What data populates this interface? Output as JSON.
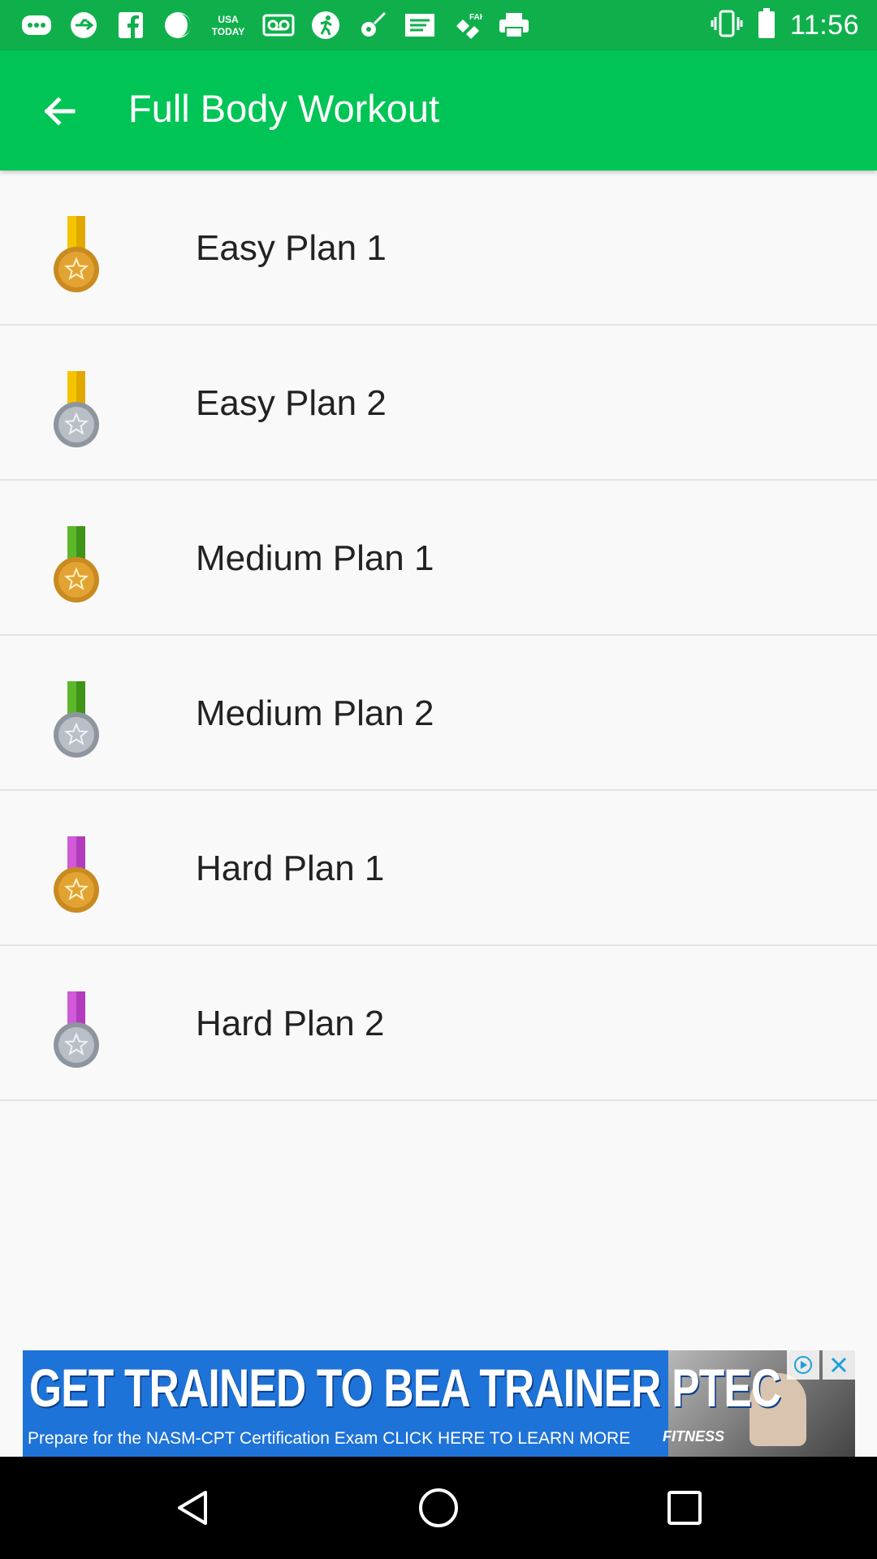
{
  "status_bar": {
    "time": "11:56",
    "left_icons": [
      "chat-icon",
      "usb-icon",
      "facebook-icon",
      "moon-icon",
      "usa-today-icon",
      "voicemail-icon",
      "run-icon",
      "guitar-icon",
      "message-icon",
      "fake-gps-icon",
      "print-icon"
    ],
    "usa_today_text": "USA TODAY",
    "fake_text": "FAKE"
  },
  "app_bar": {
    "title": "Full Body Workout",
    "color": "#00c455"
  },
  "plans": [
    {
      "label": "Easy Plan 1",
      "ribbon": "#f5c400",
      "ribbon_dark": "#e0a800",
      "medal": "gold"
    },
    {
      "label": "Easy Plan 2",
      "ribbon": "#f5c400",
      "ribbon_dark": "#e0a800",
      "medal": "silver"
    },
    {
      "label": "Medium Plan 1",
      "ribbon": "#5cb82a",
      "ribbon_dark": "#3e9318",
      "medal": "gold"
    },
    {
      "label": "Medium Plan 2",
      "ribbon": "#5cb82a",
      "ribbon_dark": "#3e9318",
      "medal": "silver"
    },
    {
      "label": "Hard Plan 1",
      "ribbon": "#d05ad8",
      "ribbon_dark": "#b33cbd",
      "medal": "gold"
    },
    {
      "label": "Hard Plan 2",
      "ribbon": "#d05ad8",
      "ribbon_dark": "#b33cbd",
      "medal": "silver"
    }
  ],
  "ad": {
    "headline": "GET TRAINED TO BEA TRAINER PTEC",
    "subline": "Prepare for the NASM-CPT Certification Exam CLICK HERE TO LEARN MORE",
    "brand": "FITNESS"
  }
}
